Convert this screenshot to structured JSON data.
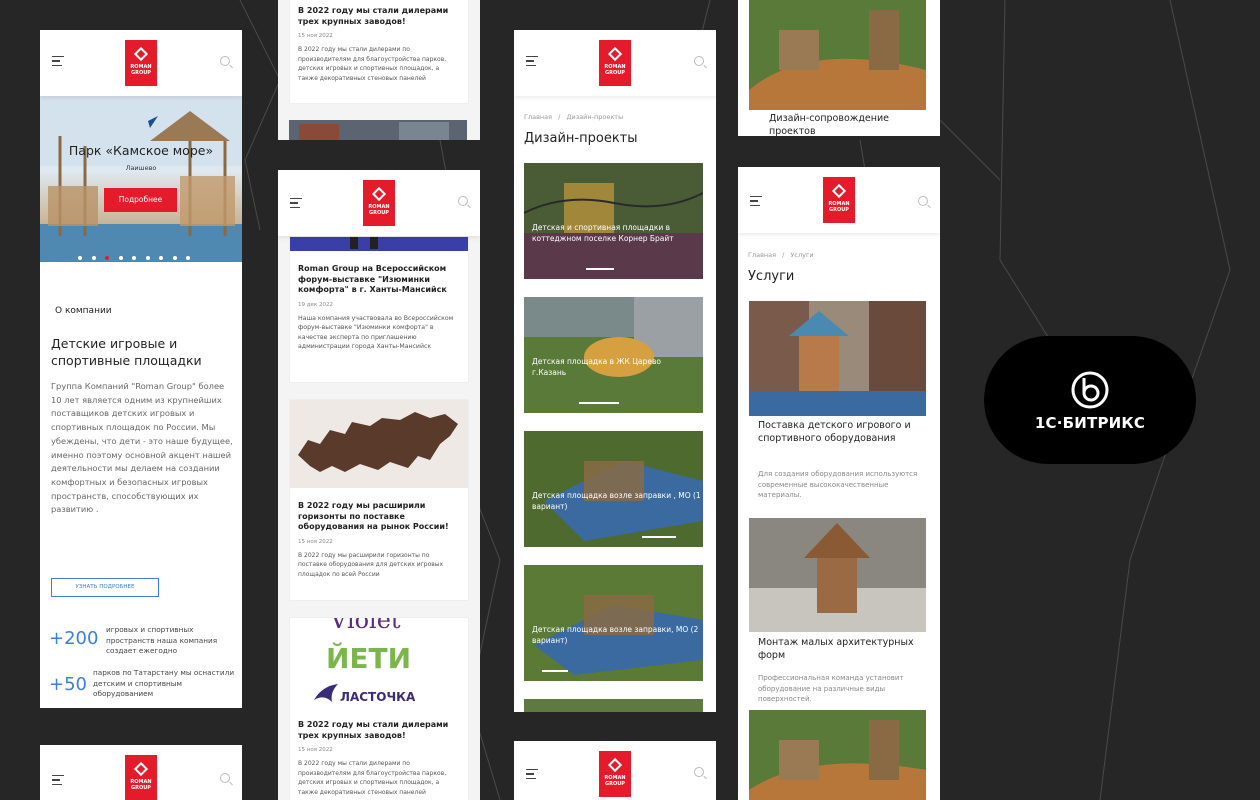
{
  "screen1": {
    "logo": "ROMAN GROUP",
    "hero": {
      "title": "Парк «Камское море»",
      "subtitle": "Лаишево",
      "button": "Подробнее",
      "dots_total": 10,
      "dot_active": 3
    },
    "about": {
      "section_label": "О компании",
      "title": "Детские игровые и спортивные площадки",
      "text": "Группа Компаний \"Roman Group\" более 10 лет является одним из крупнейших поставщиков детских игровых и спортивных площадок по России. Мы убеждены, что дети - это наше будущее, именно поэтому основной акцент нашей деятельности мы делаем на создании комфортных и безопасных игровых пространств, способствующих их развитию .",
      "more_button": "УЗНАТЬ ПОДРОБНЕЕ"
    },
    "stats": [
      {
        "value": "+200",
        "text": "игровых и спортивных пространств наша компания создает ежегодно"
      },
      {
        "value": "+50",
        "text": "парков по Татарстану мы оснастили детским и спортивным оборудованием"
      }
    ]
  },
  "screen5": {
    "logo": "ROMAN GROUP"
  },
  "screen2_top": {
    "title": "В 2022 году мы стали дилерами трех крупных заводов!",
    "date": "15 ноя 2022",
    "text": "В 2022 году мы стали дилерами по производителям для благоустройства парков, детских игровых и спортивных площадок, а также декоративных стеновых панелей"
  },
  "screen3": {
    "logo": "ROMAN GROUP",
    "news": [
      {
        "title": "Roman Group на Всероссийском форум-выставке \"Изюминки комфорта\" в г. Ханты-Мансийск",
        "date": "19 дек 2022",
        "text": "Наша компания участвовала во Всероссийском форум-выставке \"Изюминки комфорта\" в качестве эксперта по приглашению администрации города Ханты-Мансийск"
      },
      {
        "title": "В 2022 году мы расширили горизонты по поставке оборудования на рынок России!",
        "date": "15 ноя 2022",
        "text": "В 2022 году мы расширили горизонты по поставке оборудования для детских игровых площадок по всей России"
      },
      {
        "title": "В 2022 году мы стали дилерами трех крупных заводов!",
        "date": "15 ноя 2022",
        "text": "В 2022 году мы стали дилерами по производителям для благоустройства парков, детских игровых и спортивных площадок, а также декоративных стеновых панелей"
      }
    ],
    "brands": [
      "Violet",
      "ЙЕТИ",
      "ЛАСТОЧКА"
    ]
  },
  "screen4": {
    "logo": "ROMAN GROUP",
    "breadcrumb": {
      "home": "Главная",
      "sep": "/",
      "current": "Дизайн-проекты"
    },
    "title": "Дизайн-проекты",
    "projects": [
      "Детская и спортивная площадки в коттеджном поселке Корнер Брайт",
      "Детская площадка в ЖК Царево г.Казань",
      "Детская площадка возле заправки , МО (1 вариант)",
      "Детская площадка возле заправки, МО (2 вариант)"
    ]
  },
  "screen7": {
    "logo": "ROMAN GROUP"
  },
  "screen6_top": {
    "caption": "Дизайн-сопровождение проектов"
  },
  "screen8": {
    "logo": "ROMAN GROUP",
    "breadcrumb": {
      "home": "Главная",
      "sep": "/",
      "current": "Услуги"
    },
    "title": "Услуги",
    "services": [
      {
        "title": "Поставка детского игрового и спортивного оборудования",
        "text": "Для создания оборудования используются современные высококачественные материалы."
      },
      {
        "title": "Монтаж малых архитектурных форм",
        "text": "Профессиональная команда установит оборудование на различные виды поверхностей."
      }
    ]
  },
  "badge": {
    "text": "1С·БИТРИКС",
    "icon": "bitrix-logo-icon"
  }
}
